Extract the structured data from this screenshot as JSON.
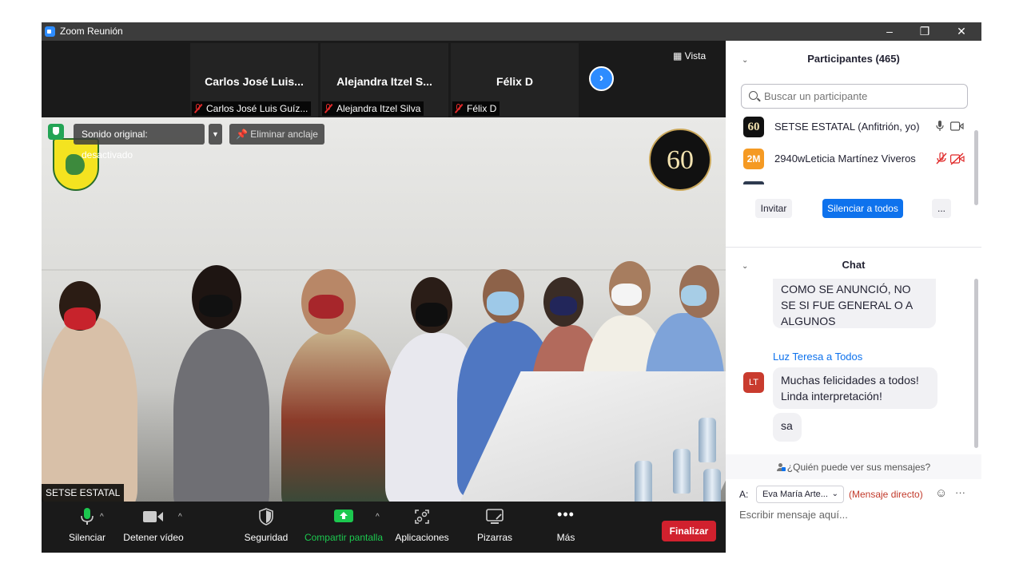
{
  "window": {
    "title": "Zoom Reunión"
  },
  "thumbs": [
    {
      "name": "Carlos José Luis...",
      "label": "Carlos José Luis Guíz..."
    },
    {
      "name": "Alejandra Itzel S...",
      "label": "Alejandra Itzel Silva"
    },
    {
      "name": "Félix D",
      "label": "Félix D"
    }
  ],
  "view_label": "Vista",
  "video": {
    "sound_label": "Sonido original: desactivado",
    "unpin_label": "Eliminar anclaje",
    "name_label": "SETSE ESTATAL",
    "logo_text": "60"
  },
  "toolbar": {
    "mute": "Silenciar",
    "video": "Detener vídeo",
    "security": "Seguridad",
    "share": "Compartir pantalla",
    "apps": "Aplicaciones",
    "whiteboards": "Pizarras",
    "more": "Más",
    "end": "Finalizar"
  },
  "participants": {
    "header": "Participantes (465)",
    "search_placeholder": "Buscar un participante",
    "list": [
      {
        "initials": "60",
        "name": "SETSE ESTATAL (Anfitrión, yo)",
        "avatar_color": "#111111"
      },
      {
        "initials": "2M",
        "name": "2940wLeticia Martínez Viveros",
        "avatar_color": "#f59a23"
      }
    ],
    "invite": "Invitar",
    "mute_all": "Silenciar a todos",
    "more": "..."
  },
  "chat": {
    "header": "Chat",
    "message1": "COMO SE ANUNCIÓ, NO SE SI FUE GENERAL O A ALGUNOS",
    "sender": "Luz Teresa a Todos",
    "sender_initials": "LT",
    "message2": "Muchas felicidades a todos! Linda interpretación!",
    "message3": "sa",
    "who_can_see": "¿Quién puede ver sus mensajes?",
    "to_label": "A:",
    "to_value": "Eva María Arte...",
    "direct_label": "(Mensaje directo)",
    "compose_placeholder": "Escribir mensaje aquí..."
  },
  "colors": {
    "accent": "#0e72ed",
    "end": "#d1212e",
    "share": "#1cc84f"
  }
}
